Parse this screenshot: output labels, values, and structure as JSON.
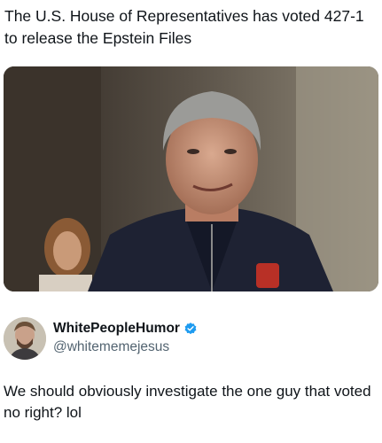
{
  "headline": "The U.S. House of Representatives has voted 427-1 to release the Epstein Files",
  "author": {
    "display_name": "WhitePeopleHumor",
    "handle": "@whitememejesus",
    "verified": true,
    "verified_color": "#1d9bf0"
  },
  "tweet_text": "We should obviously investigate the one guy that voted no right? lol",
  "icons": {
    "verified": "verified-badge-icon",
    "avatar": "profile-avatar"
  }
}
